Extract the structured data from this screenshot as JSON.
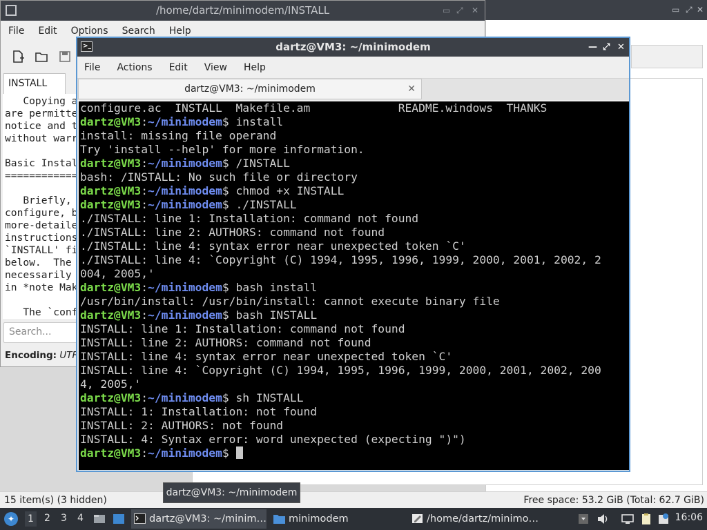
{
  "file_manager": {
    "status_left": "15 item(s) (3 hidden)",
    "status_right": "Free space: 53.2 GiB (Total: 62.7 GiB)"
  },
  "editor": {
    "title": "/home/dartz/minimodem/INSTALL",
    "menu": [
      "File",
      "Edit",
      "Options",
      "Search",
      "Help"
    ],
    "tab_label": "INSTALL",
    "text_lines": [
      "   Copying a",
      "are permitte",
      "notice and t",
      "without warr",
      "",
      "Basic Instal",
      "=============",
      "",
      "   Briefly, ",
      "configure, b",
      "more-detaile",
      "instructions",
      "`INSTALL' fi",
      "below.  The ",
      "necessarily ",
      "in *note Mak",
      "",
      "   The `conf"
    ],
    "search_placeholder": "Search...",
    "encoding_label": "Encoding:",
    "encoding_value": "UTF-"
  },
  "terminal": {
    "title": "dartz@VM3: ~/minimodem",
    "menu": [
      "File",
      "Actions",
      "Edit",
      "View",
      "Help"
    ],
    "tab_label": "dartz@VM3: ~/minimodem",
    "prompt_user": "dartz@VM3",
    "prompt_path": "~/minimodem",
    "lines": [
      {
        "type": "out",
        "text": "configure.ac  INSTALL  Makefile.am             README.windows  THANKS"
      },
      {
        "type": "cmd",
        "text": " install"
      },
      {
        "type": "out",
        "text": "install: missing file operand"
      },
      {
        "type": "out",
        "text": "Try 'install --help' for more information."
      },
      {
        "type": "cmd",
        "text": " /INSTALL"
      },
      {
        "type": "out",
        "text": "bash: /INSTALL: No such file or directory"
      },
      {
        "type": "cmd",
        "text": " chmod +x INSTALL"
      },
      {
        "type": "cmd",
        "text": " ./INSTALL"
      },
      {
        "type": "out",
        "text": "./INSTALL: line 1: Installation: command not found"
      },
      {
        "type": "out",
        "text": "./INSTALL: line 2: AUTHORS: command not found"
      },
      {
        "type": "out",
        "text": "./INSTALL: line 4: syntax error near unexpected token `C'"
      },
      {
        "type": "out",
        "text": "./INSTALL: line 4: `Copyright (C) 1994, 1995, 1996, 1999, 2000, 2001, 2002, 2"
      },
      {
        "type": "out",
        "text": "004, 2005,'"
      },
      {
        "type": "cmd",
        "text": " bash install"
      },
      {
        "type": "out",
        "text": "/usr/bin/install: /usr/bin/install: cannot execute binary file"
      },
      {
        "type": "cmd",
        "text": " bash INSTALL"
      },
      {
        "type": "out",
        "text": "INSTALL: line 1: Installation: command not found"
      },
      {
        "type": "out",
        "text": "INSTALL: line 2: AUTHORS: command not found"
      },
      {
        "type": "out",
        "text": "INSTALL: line 4: syntax error near unexpected token `C'"
      },
      {
        "type": "out",
        "text": "INSTALL: line 4: `Copyright (C) 1994, 1995, 1996, 1999, 2000, 2001, 2002, 200"
      },
      {
        "type": "out",
        "text": "4, 2005,'"
      },
      {
        "type": "cmd",
        "text": " sh INSTALL"
      },
      {
        "type": "out",
        "text": "INSTALL: 1: Installation: not found"
      },
      {
        "type": "out",
        "text": "INSTALL: 2: AUTHORS: not found"
      },
      {
        "type": "out",
        "text": "INSTALL: 4: Syntax error: word unexpected (expecting \")\")"
      },
      {
        "type": "prompt",
        "text": " "
      }
    ]
  },
  "tooltip": "dartz@VM3: ~/minimodem",
  "taskbar": {
    "workspaces": [
      "1",
      "2",
      "3",
      "4"
    ],
    "tasks": [
      {
        "label": "dartz@VM3: ~/minim…",
        "icon": "terminal-icon",
        "active": true
      },
      {
        "label": "minimodem",
        "icon": "folder-icon",
        "active": false
      },
      {
        "label": "/home/dartz/minimo…",
        "icon": "text-editor-icon",
        "active": false
      }
    ],
    "clock": "16:06"
  },
  "colors": {
    "prompt_user": "#7cdc4b",
    "prompt_path": "#6e8cf0",
    "window_accent": "#5b98d3",
    "titlebar": "#3c4047"
  }
}
